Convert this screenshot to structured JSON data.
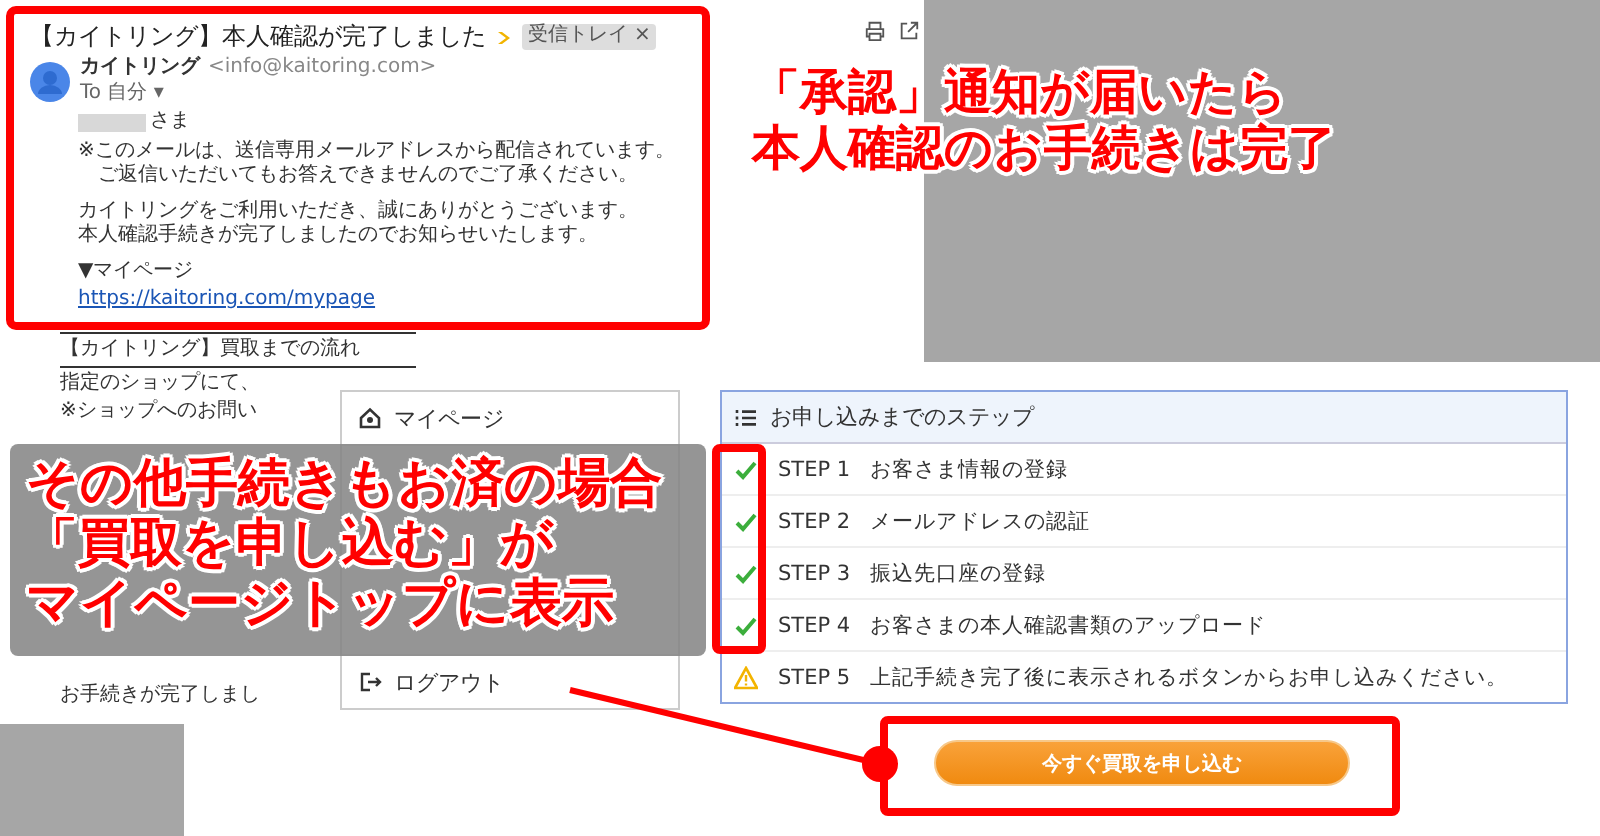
{
  "email": {
    "subject": "【カイトリング】本人確認が完了しました",
    "folder_tag": "受信トレイ",
    "folder_tag_close": "×",
    "sender": "カイトリング",
    "sender_address": "<info@kaitoring.com>",
    "recipient": "To 自分 ▾",
    "salutation": "さま",
    "paragraphs": [
      [
        "※このメールは、送信専用メールアドレスから配信されています。",
        "　ご返信いただいてもお答えできませんのでご了承ください。"
      ],
      [
        "カイトリングをご利用いただき、誠にありがとうございます。",
        "本人確認手続きが完了しましたのでお知らせいたします。"
      ],
      [
        "▼マイページ"
      ]
    ],
    "link": "https://kaitoring.com/mypage",
    "section_title": "【カイトリング】買取までの流れ",
    "section_lines": [
      "指定のショップにて、",
      "※ショップへのお問い"
    ],
    "closing": "お手続きが完了しまし"
  },
  "menu": {
    "items": [
      {
        "kind": "home",
        "label": "マイページ"
      },
      {
        "kind": "logout",
        "label": "ログアウト"
      }
    ]
  },
  "steps": {
    "title": "お申し込みまでのステップ",
    "items": [
      {
        "label": "STEP 1",
        "text": "お客さま情報の登録",
        "done": true
      },
      {
        "label": "STEP 2",
        "text": "メールアドレスの認証",
        "done": true
      },
      {
        "label": "STEP 3",
        "text": "振込先口座の登録",
        "done": true
      },
      {
        "label": "STEP 4",
        "text": "お客さまの本人確認書類のアップロード",
        "done": true
      },
      {
        "label": "STEP 5",
        "text": "上記手続き完了後に表示されるボタンからお申し込みください。",
        "done": false
      }
    ]
  },
  "cta": {
    "label": "今すぐ買取を申し込む"
  },
  "top_callout": {
    "lines": [
      "「承認」通知が届いたら",
      "本人確認のお手続きは完了"
    ]
  },
  "overlay_callout": {
    "lines": [
      "その他手続きもお済の場合",
      "「買取を申し込む」が",
      "マイページトップに表示"
    ]
  }
}
